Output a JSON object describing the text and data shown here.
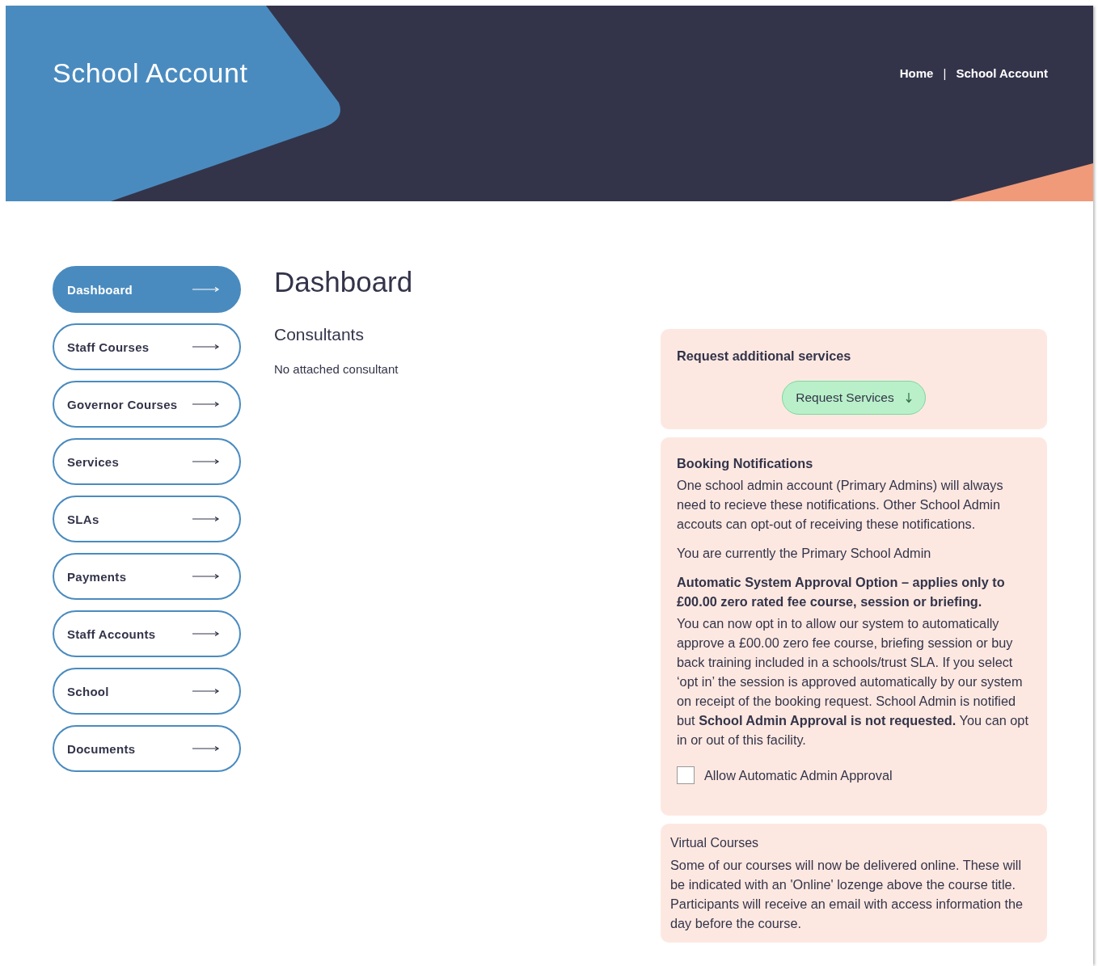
{
  "header": {
    "title": "School Account",
    "breadcrumbs": [
      {
        "label": "Home"
      },
      {
        "label": "School Account"
      }
    ],
    "separator": "|"
  },
  "sidebar": {
    "items": [
      {
        "label": "Dashboard",
        "selected": true
      },
      {
        "label": "Staff Courses",
        "selected": false
      },
      {
        "label": "Governor Courses",
        "selected": false
      },
      {
        "label": "Services",
        "selected": false
      },
      {
        "label": "SLAs",
        "selected": false
      },
      {
        "label": "Payments",
        "selected": false
      },
      {
        "label": "Staff Accounts",
        "selected": false
      },
      {
        "label": "School",
        "selected": false
      },
      {
        "label": "Documents",
        "selected": false
      }
    ]
  },
  "main": {
    "title": "Dashboard",
    "consultants": {
      "heading": "Consultants",
      "text": "No attached consultant"
    }
  },
  "request_card": {
    "heading": "Request additional services",
    "button": "Request Services"
  },
  "notifications_card": {
    "heading": "Booking Notifications",
    "paragraphs": [
      "One school admin account (Primary Admins) will always need to recieve these notifications. Other School Admin accouts can opt-out of receiving these notifications.",
      "You are currently the Primary School Admin"
    ],
    "approval_heading": "Automatic System Approval Option – applies only to £00.00 zero rated fee course, session or briefing.",
    "approval_text": "You can now opt in to allow our system to automatically approve a £00.00 zero fee course, briefing session or buy back training included in a schools/trust SLA. If you select ‘opt in’ the session is approved automatically by our system on receipt of the booking request. School Admin is notified but **School Admin Approval is not requested.** You can opt in or out of this facility.",
    "checkbox": {
      "label": "Allow Automatic Admin Approval",
      "checked": false
    }
  },
  "virtual_card": {
    "heading": "Virtual Courses",
    "text": "Some of our courses will now be delivered online.  These will be indicated with an 'Online' lozenge above the course title.  Participants will receive an email with access information the day before the course."
  }
}
